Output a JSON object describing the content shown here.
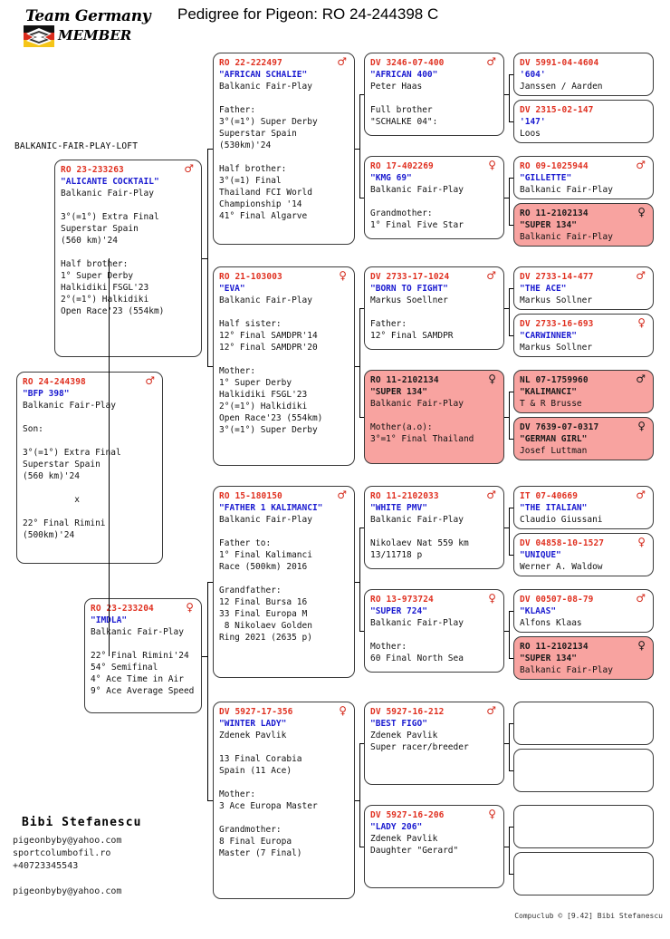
{
  "header": {
    "logo_line1": "Team Germany",
    "logo_line2": "MEMBER",
    "title": "Pedigree for Pigeon: RO  24-244398 C"
  },
  "loft_label": "BALKANIC-FAIR-PLAY-LOFT",
  "footer": {
    "owner": "Bibi Stefanescu",
    "email": "pigeonbyby@yahoo.com",
    "site": "sportcolumbofil.ro",
    "phone": "+40723345543",
    "email2": "pigeonbyby@yahoo.com",
    "credit": "Compuclub © [9.42]  Bibi Stefanescu"
  },
  "colors": {
    "ring": "#e03020",
    "name": "#1a1ad0",
    "highlight": "#f8a3a0",
    "border": "#3a3a3a"
  },
  "boxes": {
    "subject": {
      "ring": "RO  24-244398",
      "sex": "male",
      "name": "\"BFP 398\"",
      "lines": [
        "Balkanic Fair-Play",
        "",
        "Son:",
        "",
        "3°(=1°) Extra Final",
        "Superstar Spain",
        "(560 km)'24",
        "",
        "          x",
        "",
        "22° Final Rimini",
        "(500km)'24"
      ],
      "highlight": false
    },
    "g1_sire": {
      "ring": "RO  23-233263",
      "sex": "male",
      "name": "\"ALICANTE COCKTAIL\"",
      "lines": [
        "Balkanic Fair-Play",
        "",
        "3°(=1°) Extra Final",
        "Superstar Spain",
        "(560 km)'24",
        "",
        "Half brother:",
        "1° Super Derby",
        "Halkidiki FSGL'23",
        "2°(=1°) Halkidiki",
        "Open Race'23 (554km)"
      ],
      "highlight": false
    },
    "g1_dam": {
      "ring": "RO  23-233204",
      "sex": "female",
      "name": "\"IMDLA\"",
      "lines": [
        "Balkanic Fair-Play",
        "",
        "22° Final Rimini'24",
        "54° Semifinal",
        "4° Ace Time in Air",
        "9° Ace Average Speed"
      ],
      "highlight": false
    },
    "g2_1": {
      "ring": "RO  22-222497",
      "sex": "male",
      "name": "\"AFRICAN SCHALIE\"",
      "lines": [
        "Balkanic Fair-Play",
        "",
        "Father:",
        "3°(=1°) Super Derby",
        "Superstar Spain",
        "(530km)'24",
        "",
        "Half brother:",
        "3°(=1) Final",
        "Thailand FCI World",
        "Championship '14",
        "41° Final Algarve"
      ],
      "highlight": false
    },
    "g2_2": {
      "ring": "RO  21-103003",
      "sex": "female",
      "name": "\"EVA\"",
      "lines": [
        "Balkanic Fair-Play",
        "",
        "Half sister:",
        "12° Final SAMDPR'14",
        "12° Final SAMDPR'20",
        "",
        "Mother:",
        "1° Super Derby",
        "Halkidiki FSGL'23",
        "2°(=1°) Halkidiki",
        "Open Race'23 (554km)",
        "3°(=1°) Super Derby"
      ],
      "highlight": false
    },
    "g2_3": {
      "ring": "RO  15-180150",
      "sex": "male",
      "name": "\"FATHER 1 KALIMANCI\"",
      "lines": [
        "Balkanic Fair-Play",
        "",
        "Father to:",
        "1° Final Kalimanci",
        "Race (500km) 2016",
        "",
        "Grandfather:",
        "12 Final Bursa 16",
        "33 Final Europa M",
        " 8 Nikolaev Golden",
        "Ring 2021 (2635 p)"
      ],
      "highlight": false
    },
    "g2_4": {
      "ring": "DV  5927-17-356",
      "sex": "female",
      "name": "\"WINTER LADY\"",
      "lines": [
        "Zdenek Pavlik",
        "",
        "13 Final Corabia",
        "Spain (11 Ace)",
        "",
        "Mother:",
        "3 Ace Europa Master",
        "",
        "Grandmother:",
        "8 Final Europa",
        "Master (7 Final)"
      ],
      "highlight": false
    },
    "g3_1": {
      "ring": "DV  3246-07-400",
      "sex": "male",
      "name": "\"AFRICAN 400\"",
      "lines": [
        "Peter Haas",
        "",
        "Full brother",
        "\"SCHALKE 04\":"
      ],
      "highlight": false
    },
    "g3_2": {
      "ring": "RO  17-402269",
      "sex": "female",
      "name": "\"KMG 69\"",
      "lines": [
        "Balkanic Fair-Play",
        "",
        "Grandmother:",
        "1° Final Five Star"
      ],
      "highlight": false
    },
    "g3_3": {
      "ring": "DV  2733-17-1024",
      "sex": "male",
      "name": "\"BORN TO FIGHT\"",
      "lines": [
        "Markus Soellner",
        "",
        "Father:",
        "12° Final SAMDPR"
      ],
      "highlight": false
    },
    "g3_4": {
      "ring": "RO  11-2102134",
      "sex": "female",
      "name": "\"SUPER 134\"",
      "lines": [
        "Balkanic Fair-Play",
        "",
        "Mother(a.o):",
        "3°=1° Final Thailand"
      ],
      "highlight": true
    },
    "g3_5": {
      "ring": "RO  11-2102033",
      "sex": "male",
      "name": "\"WHITE PMV\"",
      "lines": [
        "Balkanic Fair-Play",
        "",
        "Nikolaev Nat 559 km",
        "13/11718 p"
      ],
      "highlight": false
    },
    "g3_6": {
      "ring": "RO  13-973724",
      "sex": "female",
      "name": "\"SUPER 724\"",
      "lines": [
        "Balkanic Fair-Play",
        "",
        "Mother:",
        "60 Final North Sea"
      ],
      "highlight": false
    },
    "g3_7": {
      "ring": "DV  5927-16-212",
      "sex": "male",
      "name": "\"BEST FIGO\"",
      "lines": [
        "Zdenek Pavlik",
        "Super racer/breeder"
      ],
      "highlight": false
    },
    "g3_8": {
      "ring": "DV  5927-16-206",
      "sex": "female",
      "name": "\"LADY 206\"",
      "lines": [
        "Zdenek Pavlik",
        "Daughter \"Gerard\""
      ],
      "highlight": false
    },
    "g4_1": {
      "ring": "DV  5991-04-4604",
      "sex": "",
      "name": "'604'",
      "lines": [
        "Janssen / Aarden"
      ],
      "highlight": false
    },
    "g4_2": {
      "ring": "DV  2315-02-147",
      "sex": "",
      "name": "'147'",
      "lines": [
        "Loos"
      ],
      "highlight": false
    },
    "g4_3": {
      "ring": "RO  09-1025944",
      "sex": "male",
      "name": "\"GILLETTE\"",
      "lines": [
        "Balkanic Fair-Play"
      ],
      "highlight": false
    },
    "g4_4": {
      "ring": "RO  11-2102134",
      "sex": "female",
      "name": "\"SUPER 134\"",
      "lines": [
        "Balkanic Fair-Play"
      ],
      "highlight": true
    },
    "g4_5": {
      "ring": "DV  2733-14-477",
      "sex": "male",
      "name": "\"THE ACE\"",
      "lines": [
        "Markus Sollner"
      ],
      "highlight": false
    },
    "g4_6": {
      "ring": "DV  2733-16-693",
      "sex": "female",
      "name": "\"CARWINNER\"",
      "lines": [
        "Markus Sollner"
      ],
      "highlight": false
    },
    "g4_7": {
      "ring": "NL  07-1759960",
      "sex": "male",
      "name": "\"KALIMANCI\"",
      "lines": [
        "T & R Brusse"
      ],
      "highlight": true
    },
    "g4_8": {
      "ring": "DV  7639-07-0317",
      "sex": "female",
      "name": "\"GERMAN GIRL\"",
      "lines": [
        "Josef Luttman"
      ],
      "highlight": true
    },
    "g4_9": {
      "ring": "IT  07-40669",
      "sex": "male",
      "name": "\"THE ITALIAN\"",
      "lines": [
        "Claudio Giussani"
      ],
      "highlight": false
    },
    "g4_10": {
      "ring": "DV  04858-10-1527",
      "sex": "female",
      "name": "\"UNIQUE\"",
      "lines": [
        "Werner A. Waldow"
      ],
      "highlight": false
    },
    "g4_11": {
      "ring": "DV  00507-08-79",
      "sex": "male",
      "name": "\"KLAAS\"",
      "lines": [
        "Alfons Klaas"
      ],
      "highlight": false
    },
    "g4_12": {
      "ring": "RO  11-2102134",
      "sex": "female",
      "name": "\"SUPER 134\"",
      "lines": [
        "Balkanic Fair-Play"
      ],
      "highlight": true
    },
    "g4_13": {
      "ring": "",
      "sex": "",
      "name": "",
      "lines": [],
      "highlight": false
    },
    "g4_14": {
      "ring": "",
      "sex": "",
      "name": "",
      "lines": [],
      "highlight": false
    },
    "g4_15": {
      "ring": "",
      "sex": "",
      "name": "",
      "lines": [],
      "highlight": false
    },
    "g4_16": {
      "ring": "",
      "sex": "",
      "name": "",
      "lines": [],
      "highlight": false
    }
  },
  "layout": {
    "subject": [
      18,
      410,
      162,
      212
    ],
    "g1_sire": [
      60,
      176,
      163,
      218
    ],
    "g1_dam": [
      93,
      660,
      130,
      127
    ],
    "g2_1": [
      235,
      58,
      157,
      212
    ],
    "g2_2": [
      235,
      294,
      157,
      220
    ],
    "g2_3": [
      235,
      536,
      157,
      212
    ],
    "g2_4": [
      235,
      774,
      157,
      218
    ],
    "g3_1": [
      402,
      58,
      155,
      92
    ],
    "g3_2": [
      402,
      172,
      155,
      92
    ],
    "g3_3": [
      402,
      294,
      155,
      92
    ],
    "g3_4": [
      402,
      408,
      155,
      104
    ],
    "g3_5": [
      402,
      536,
      155,
      92
    ],
    "g3_6": [
      402,
      650,
      155,
      92
    ],
    "g3_7": [
      402,
      774,
      155,
      92
    ],
    "g3_8": [
      402,
      888,
      155,
      92
    ],
    "g4_1": [
      567,
      58,
      155,
      48
    ],
    "g4_2": [
      567,
      110,
      155,
      48
    ],
    "g4_3": [
      567,
      172,
      155,
      48
    ],
    "g4_4": [
      567,
      224,
      155,
      48
    ],
    "g4_5": [
      567,
      294,
      155,
      48
    ],
    "g4_6": [
      567,
      346,
      155,
      48
    ],
    "g4_7": [
      567,
      408,
      155,
      48
    ],
    "g4_8": [
      567,
      460,
      155,
      48
    ],
    "g4_9": [
      567,
      536,
      155,
      48
    ],
    "g4_10": [
      567,
      588,
      155,
      48
    ],
    "g4_11": [
      567,
      650,
      155,
      48
    ],
    "g4_12": [
      567,
      702,
      155,
      48
    ],
    "g4_13": [
      567,
      774,
      155,
      48
    ],
    "g4_14": [
      567,
      826,
      155,
      48
    ],
    "g4_15": [
      567,
      888,
      155,
      48
    ],
    "g4_16": [
      567,
      940,
      155,
      48
    ]
  }
}
